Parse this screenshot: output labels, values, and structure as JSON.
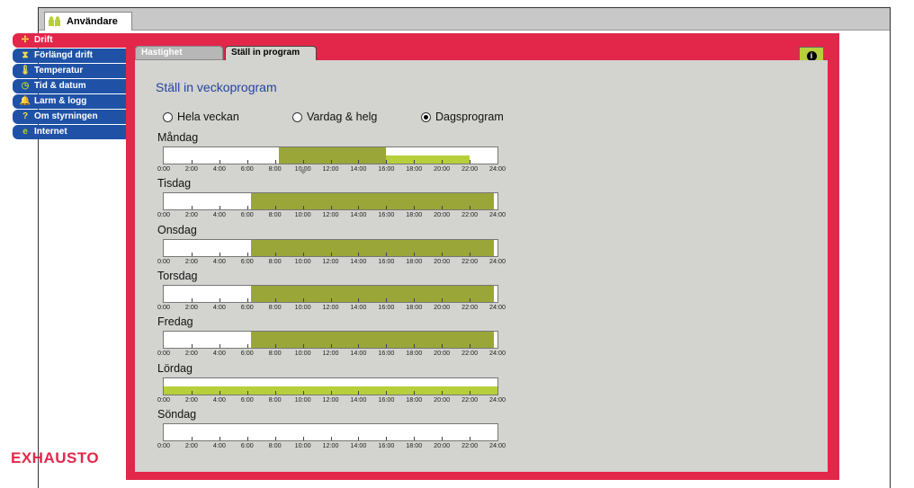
{
  "window": {
    "tab_label": "Användare"
  },
  "menu": [
    {
      "label": "Drift",
      "icon": "fan-icon",
      "active": true
    },
    {
      "label": "Förlängd drift",
      "icon": "hourglass-icon",
      "active": false
    },
    {
      "label": "Temperatur",
      "icon": "thermometer-icon",
      "active": false
    },
    {
      "label": "Tid & datum",
      "icon": "clock-icon",
      "active": false
    },
    {
      "label": "Larm & logg",
      "icon": "bell-icon",
      "active": false
    },
    {
      "label": "Om styrningen",
      "icon": "question-icon",
      "active": false
    },
    {
      "label": "Internet",
      "icon": "globe-icon",
      "active": false
    }
  ],
  "brand": "EXHAUSTO",
  "tabs": {
    "inactive": "Hastighet",
    "active": "Ställ in program"
  },
  "info_button": "i",
  "heading": "Ställ in veckoprogram",
  "radio": {
    "options": [
      "Hela veckan",
      "Vardag & helg",
      "Dagsprogram"
    ],
    "selected": "Dagsprogram"
  },
  "tick_labels": [
    "0:00",
    "2:00",
    "4:00",
    "6:00",
    "8:00",
    "10:00",
    "12:00",
    "14:00",
    "16:00",
    "18:00",
    "20:00",
    "22:00",
    "24:00"
  ],
  "colors": {
    "accent_red": "#e2274a",
    "menu_blue": "#1f52a6",
    "olive": "#9aa638",
    "lime": "#b6cf3a",
    "panel_gray": "#d3d3cf"
  },
  "days": [
    {
      "name": "Måndag",
      "segments": [
        {
          "start": 8.25,
          "end": 16.0,
          "color": "olive",
          "height": "full"
        },
        {
          "start": 16.0,
          "end": 22.0,
          "color": "lime",
          "height": "half"
        }
      ]
    },
    {
      "name": "Tisdag",
      "segments": [
        {
          "start": 6.25,
          "end": 23.75,
          "color": "olive",
          "height": "full"
        }
      ]
    },
    {
      "name": "Onsdag",
      "segments": [
        {
          "start": 6.25,
          "end": 23.75,
          "color": "olive",
          "height": "full"
        }
      ]
    },
    {
      "name": "Torsdag",
      "segments": [
        {
          "start": 6.25,
          "end": 23.75,
          "color": "olive",
          "height": "full"
        }
      ]
    },
    {
      "name": "Fredag",
      "segments": [
        {
          "start": 6.25,
          "end": 23.75,
          "color": "olive",
          "height": "full"
        }
      ]
    },
    {
      "name": "Lördag",
      "segments": [
        {
          "start": 0.0,
          "end": 24.0,
          "color": "lime",
          "height": "half"
        }
      ]
    },
    {
      "name": "Söndag",
      "segments": []
    }
  ],
  "marker_time": 10.0
}
